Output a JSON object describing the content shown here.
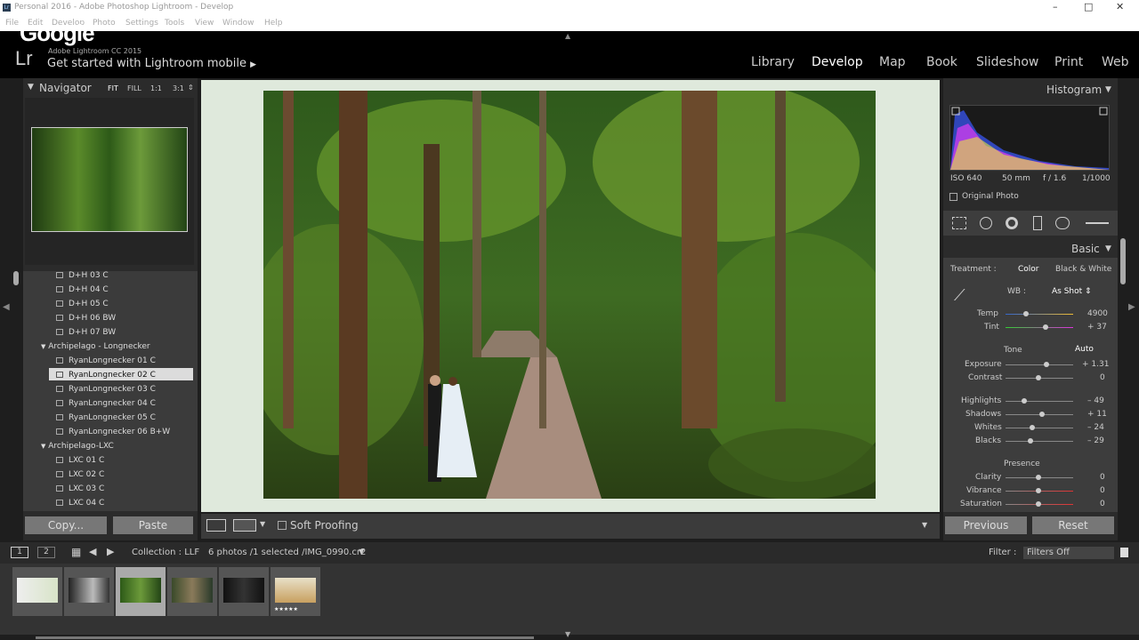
{
  "window": {
    "title": "Personal 2016 - Adobe Photoshop Lightroom - Develop",
    "min": "–",
    "max": "□",
    "close": "✕"
  },
  "menu": [
    "File",
    "Edit",
    "Develop",
    "Photo",
    "Settings",
    "Tools",
    "View",
    "Window",
    "Help"
  ],
  "identity": {
    "overlay": "Google",
    "lr": "Lr",
    "version": "Adobe Lightroom CC 2015",
    "getstarted": "Get started with Lightroom mobile"
  },
  "modules": [
    "Library",
    "Develop",
    "Map",
    "Book",
    "Slideshow",
    "Print",
    "Web"
  ],
  "navigator": {
    "title": "Navigator",
    "options": [
      "FIT",
      "FILL",
      "1:1",
      "3:1"
    ]
  },
  "collections": {
    "items_top": [
      "D+H 03 C",
      "D+H 04 C",
      "D+H 05 C",
      "D+H 06 BW",
      "D+H 07 BW"
    ],
    "folder1": "Archipelago - Longnecker",
    "items_mid": [
      "RyanLongnecker 01 C",
      "RyanLongnecker 02 C",
      "RyanLongnecker 03 C",
      "RyanLongnecker 04 C",
      "RyanLongnecker 05 C",
      "RyanLongnecker 06 B+W"
    ],
    "folder2": "Archipelago-LXC",
    "items_bottom": [
      "LXC 01 C",
      "LXC 02 C",
      "LXC 03 C",
      "LXC 04 C"
    ]
  },
  "left_buttons": {
    "copy": "Copy...",
    "paste": "Paste"
  },
  "toolbar": {
    "soft_proofing": "Soft Proofing"
  },
  "histogram": {
    "title": "Histogram",
    "iso": "ISO 640",
    "focal": "50 mm",
    "aperture": "f / 1.6",
    "shutter": "1/1000",
    "original": "Original Photo"
  },
  "basic": {
    "title": "Basic",
    "treatment": "Treatment :",
    "color": "Color",
    "bw": "Black & White",
    "wb": "WB :",
    "wb_value": "As Shot",
    "temp_label": "Temp",
    "temp_value": "4900",
    "tint_label": "Tint",
    "tint_value": "+ 37",
    "tone": "Tone",
    "auto": "Auto",
    "exposure_label": "Exposure",
    "exposure_value": "+ 1.31",
    "contrast_label": "Contrast",
    "contrast_value": "0",
    "highlights_label": "Highlights",
    "highlights_value": "– 49",
    "shadows_label": "Shadows",
    "shadows_value": "+ 11",
    "whites_label": "Whites",
    "whites_value": "– 24",
    "blacks_label": "Blacks",
    "blacks_value": "– 29",
    "presence": "Presence",
    "clarity_label": "Clarity",
    "clarity_value": "0",
    "vibrance_label": "Vibrance",
    "vibrance_value": "0",
    "saturation_label": "Saturation",
    "saturation_value": "0"
  },
  "right_buttons": {
    "previous": "Previous",
    "reset": "Reset"
  },
  "filmstrip": {
    "page1": "1",
    "page2": "2",
    "collection": "Collection : LLF",
    "count": "6 photos /1 selected /IMG_0990.cr2",
    "filter_label": "Filter :",
    "filter_value": "Filters Off",
    "rating": "★★★★★"
  },
  "colors": {
    "accent": "#dfe9dc",
    "panel": "#2b2b2b"
  }
}
